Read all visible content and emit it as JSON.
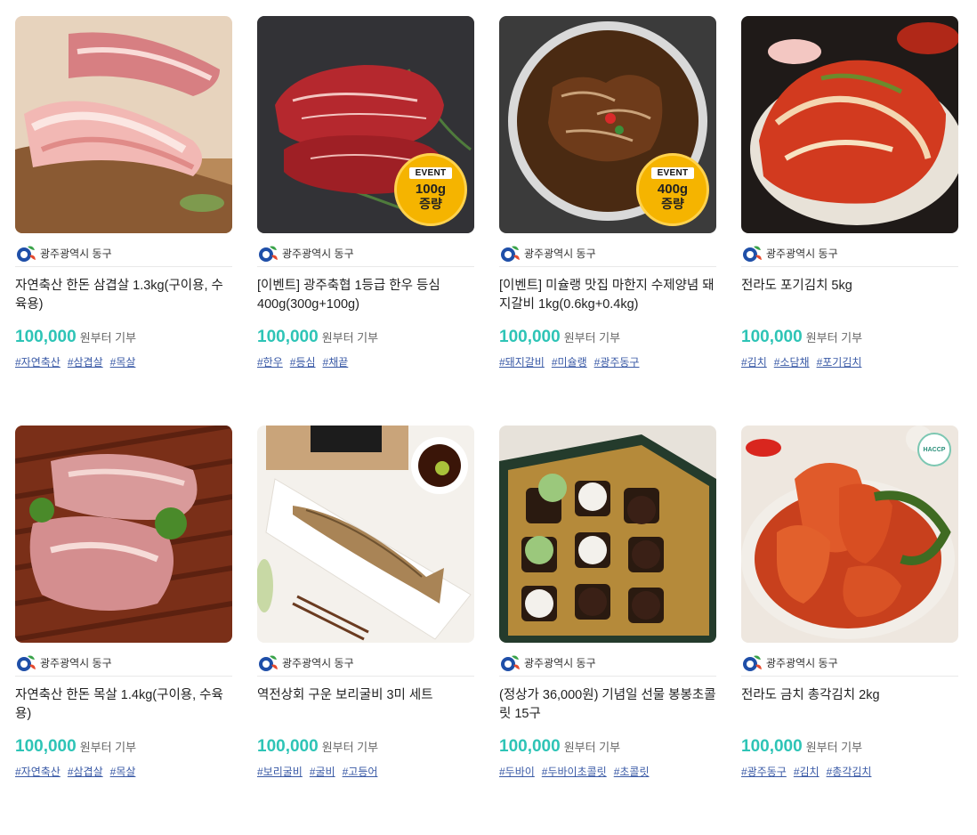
{
  "products": [
    {
      "image_desc": "pork-belly-image",
      "seller": "광주광역시 동구",
      "title": "자연축산 한돈 삼겹살 1.3kg(구이용, 수육용)",
      "price": "100,000",
      "price_suffix": "원부터 기부",
      "tags": [
        "#자연축산",
        "#삼겹살",
        "#목살"
      ]
    },
    {
      "image_desc": "korean-beef-image",
      "seller": "광주광역시 동구",
      "title": "[이벤트] 광주축협 1등급 한우 등심 400g(300g+100g)",
      "price": "100,000",
      "price_suffix": "원부터 기부",
      "tags": [
        "#한우",
        "#등심",
        "#채끝"
      ],
      "badge": {
        "event": "EVENT",
        "amount": "100g",
        "label": "증량"
      }
    },
    {
      "image_desc": "marinated-galbi-image",
      "seller": "광주광역시 동구",
      "title": "[이벤트] 미슐랭 맛집 마한지 수제양념 돼지갈비 1kg(0.6kg+0.4kg)",
      "price": "100,000",
      "price_suffix": "원부터 기부",
      "tags": [
        "#돼지갈비",
        "#미슐랭",
        "#광주동구"
      ],
      "badge": {
        "event": "EVENT",
        "amount": "400g",
        "label": "증량"
      }
    },
    {
      "image_desc": "kimchi-image",
      "seller": "광주광역시 동구",
      "title": "전라도 포기김치 5kg",
      "price": "100,000",
      "price_suffix": "원부터 기부",
      "tags": [
        "#김치",
        "#소담채",
        "#포기김치"
      ]
    },
    {
      "image_desc": "pork-neck-image",
      "seller": "광주광역시 동구",
      "title": "자연축산 한돈 목살 1.4kg(구이용, 수육용)",
      "price": "100,000",
      "price_suffix": "원부터 기부",
      "tags": [
        "#자연축산",
        "#삼겹살",
        "#목살"
      ]
    },
    {
      "image_desc": "grilled-fish-image",
      "seller": "광주광역시 동구",
      "title": "역전상회 구운 보리굴비 3미 세트",
      "price": "100,000",
      "price_suffix": "원부터 기부",
      "tags": [
        "#보리굴비",
        "#굴비",
        "#고등어"
      ]
    },
    {
      "image_desc": "chocolate-box-image",
      "seller": "광주광역시 동구",
      "title": "(정상가 36,000원) 기념일 선물 봉봉초콜릿 15구",
      "price": "100,000",
      "price_suffix": "원부터 기부",
      "tags": [
        "#두바이",
        "#두바이초콜릿",
        "#초콜릿"
      ]
    },
    {
      "image_desc": "radish-kimchi-image",
      "seller": "광주광역시 동구",
      "title": "전라도 금치 총각김치 2kg",
      "price": "100,000",
      "price_suffix": "원부터 기부",
      "tags": [
        "#광주동구",
        "#김치",
        "#총각김치"
      ],
      "haccp": "HACCP"
    }
  ],
  "colors": {
    "price": "#2ec4b6",
    "tag": "#3a5aa6",
    "badge": "#f5b400"
  }
}
